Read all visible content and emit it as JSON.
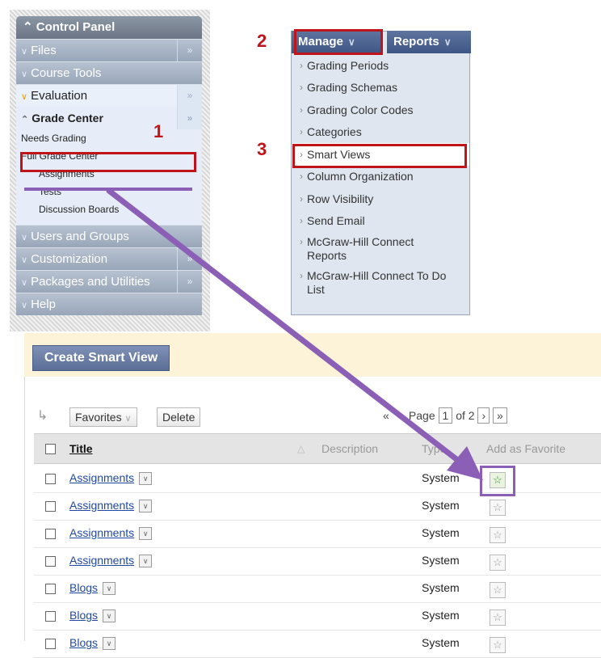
{
  "control_panel": {
    "title": "Control Panel",
    "items_top": [
      {
        "label": "Files"
      },
      {
        "label": "Course Tools"
      },
      {
        "label": "Evaluation"
      }
    ],
    "grade_center": {
      "title": "Grade Center",
      "links": [
        "Needs Grading",
        "Full Grade Center"
      ],
      "sublinks": [
        "Assignments",
        "Tests",
        "Discussion Boards"
      ]
    },
    "items_bottom": [
      {
        "label": "Users and Groups"
      },
      {
        "label": "Customization"
      },
      {
        "label": "Packages and Utilities"
      },
      {
        "label": "Help"
      }
    ]
  },
  "annotations": {
    "step1": "1",
    "step2": "2",
    "step3": "3"
  },
  "menu": {
    "manage_label": "Manage",
    "reports_label": "Reports",
    "items": [
      "Grading Periods",
      "Grading Schemas",
      "Grading Color Codes",
      "Categories",
      "Smart Views",
      "Column Organization",
      "Row Visibility",
      "Send Email",
      "McGraw-Hill Connect Reports",
      "McGraw-Hill Connect To Do List"
    ]
  },
  "smart_views": {
    "create_label": "Create Smart View",
    "favorites_label": "Favorites",
    "delete_label": "Delete",
    "pager": {
      "page_label": "Page",
      "page": "1",
      "of_label": "of 2"
    },
    "headers": {
      "title": "Title",
      "description": "Description",
      "type": "Type",
      "favorite": "Add as Favorite"
    },
    "rows": [
      {
        "title": "Assignments",
        "type": "System"
      },
      {
        "title": "Assignments",
        "type": "System"
      },
      {
        "title": "Assignments",
        "type": "System"
      },
      {
        "title": "Assignments",
        "type": "System"
      },
      {
        "title": "Blogs",
        "type": "System"
      },
      {
        "title": "Blogs",
        "type": "System"
      },
      {
        "title": "Blogs",
        "type": "System"
      }
    ]
  },
  "colors": {
    "annotation_red": "#c0141b",
    "annotation_purple": "#8a5fb5"
  }
}
